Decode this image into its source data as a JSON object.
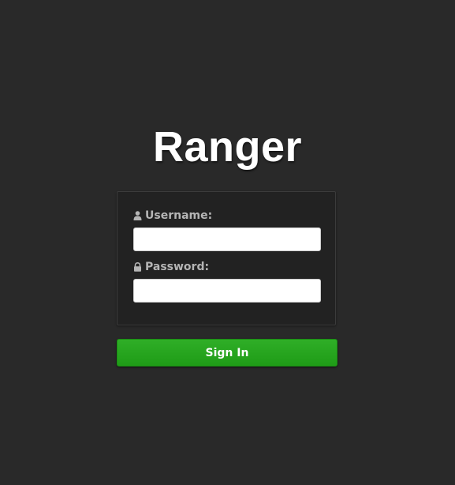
{
  "app": {
    "logo_text": "Ranger"
  },
  "login_form": {
    "username": {
      "label": "Username:",
      "icon": "user-icon",
      "value": ""
    },
    "password": {
      "label": "Password:",
      "icon": "lock-icon",
      "value": ""
    },
    "submit_label": "Sign In"
  },
  "colors": {
    "background": "#292929",
    "panel": "#222222",
    "label": "#b5b5b5",
    "button": "#22a31b"
  }
}
